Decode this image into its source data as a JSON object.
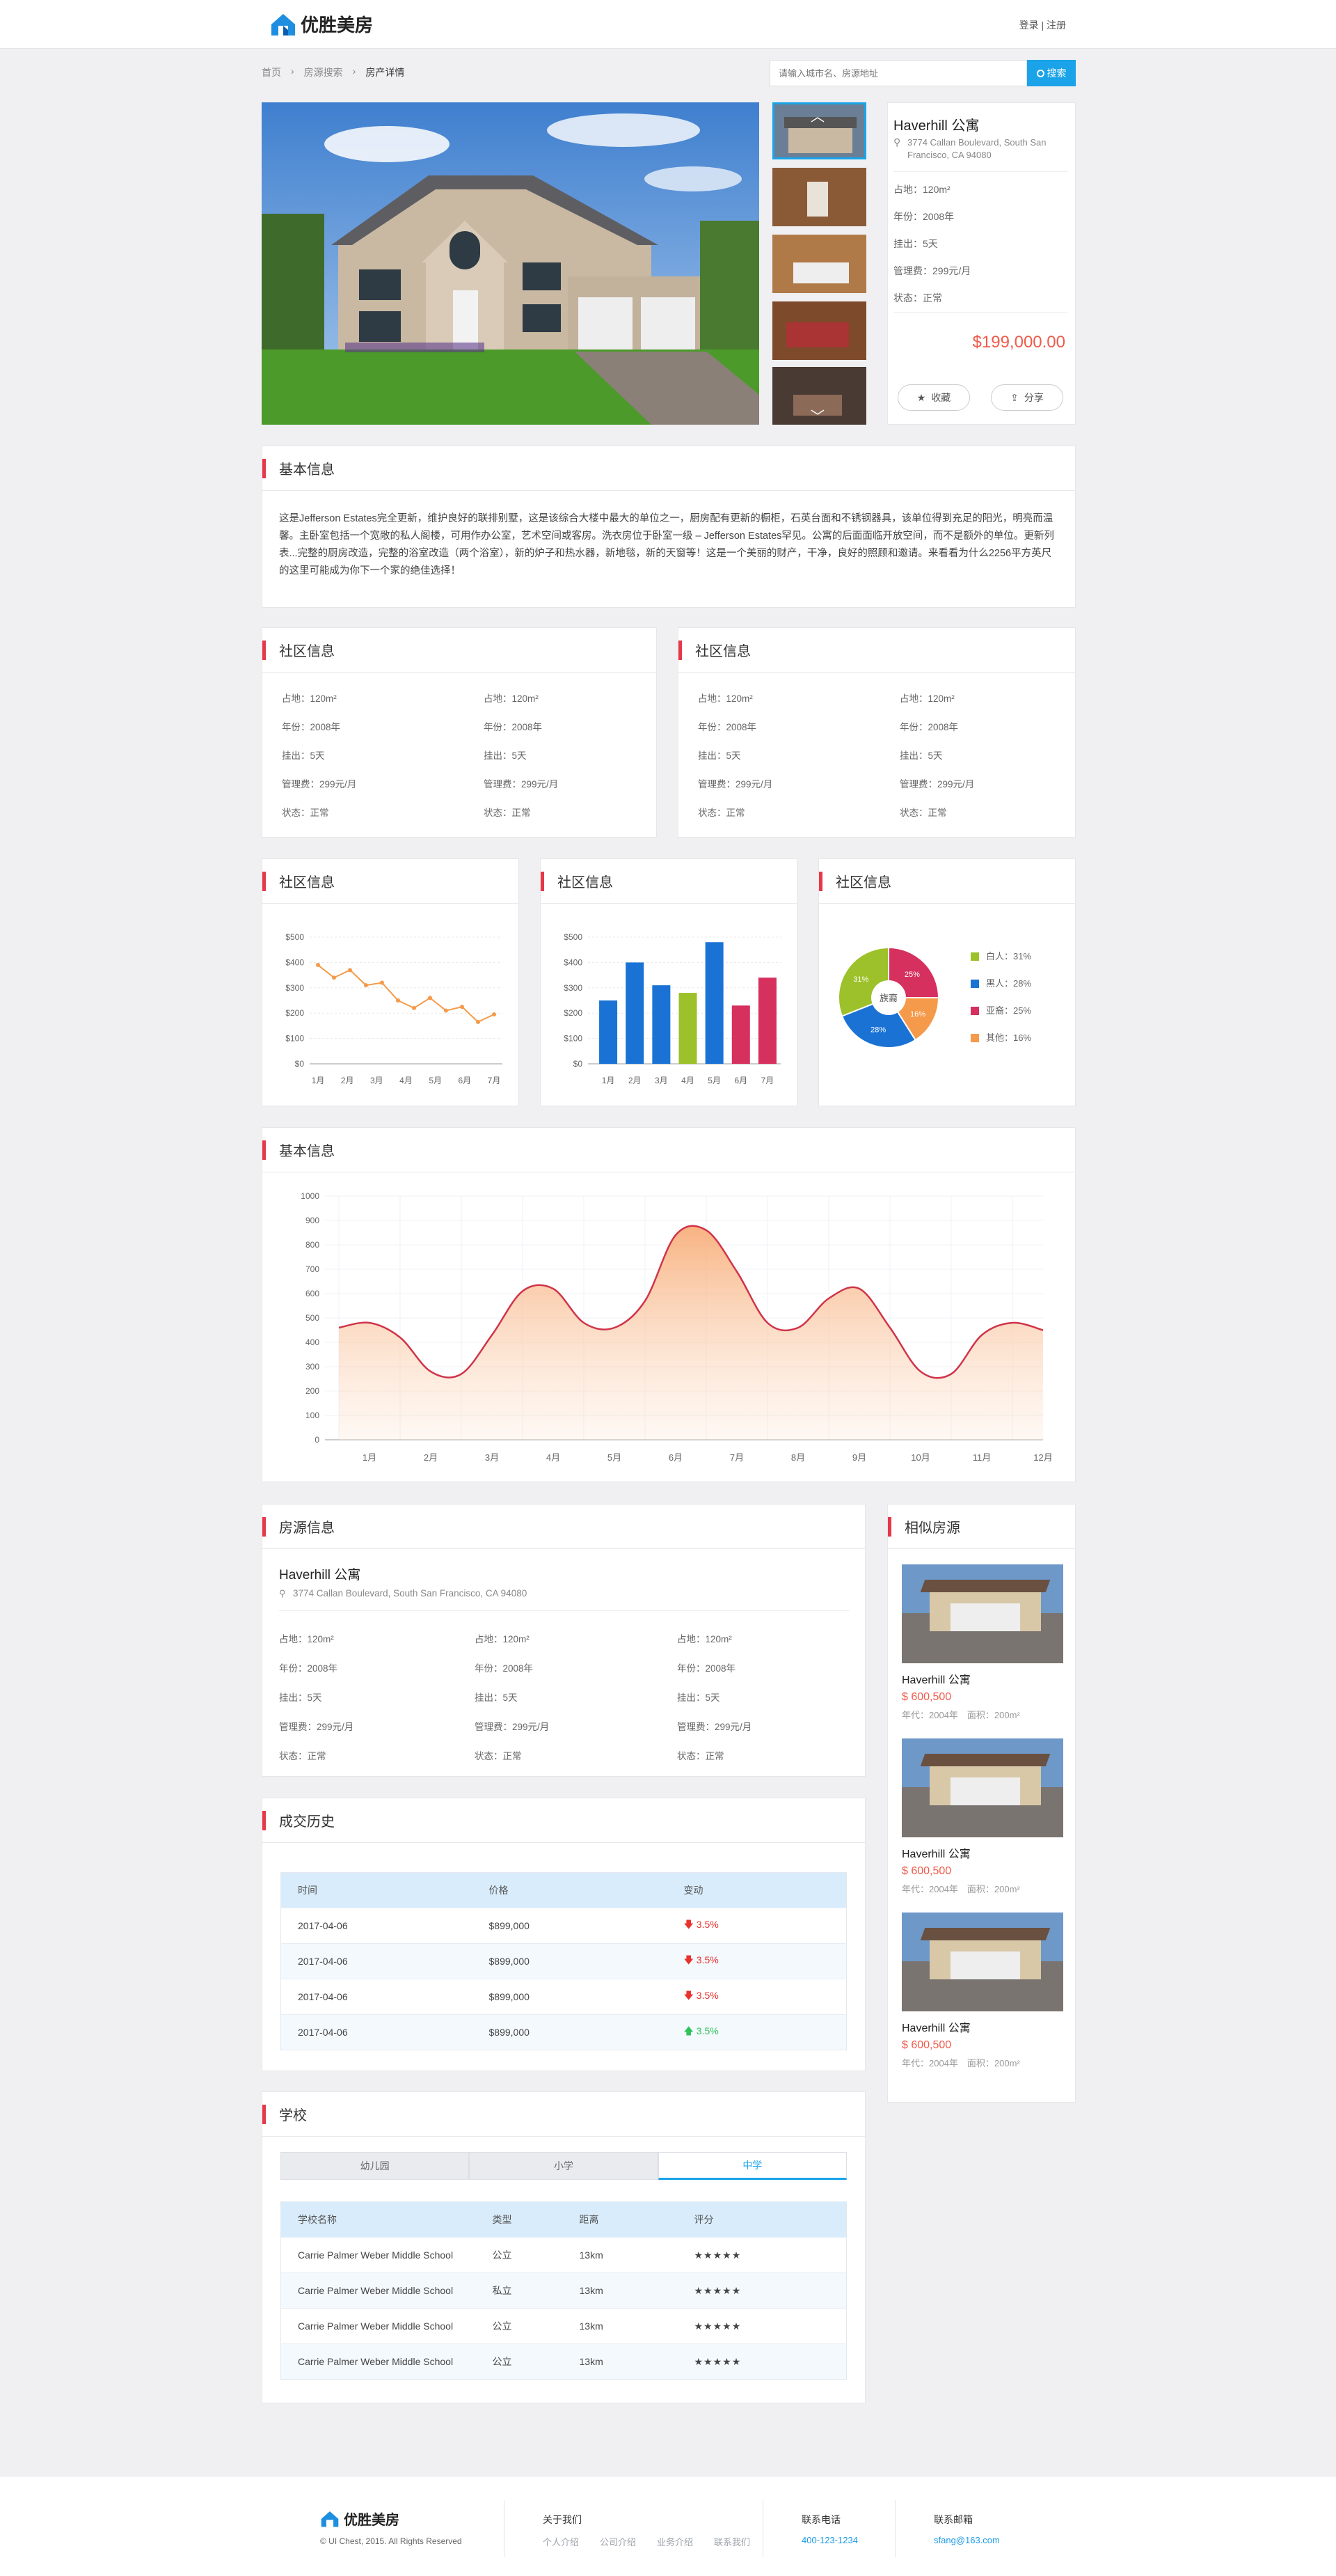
{
  "header": {
    "brand": "优胜美房",
    "auth": "登录 | 注册"
  },
  "breadcrumb": {
    "home": "首页",
    "search": "房源搜索",
    "current": "房产详情"
  },
  "search": {
    "placeholder": "请输入城市名、房源地址",
    "button": "搜索"
  },
  "property": {
    "title": "Haverhill 公寓",
    "address": "3774 Callan Boulevard, South San Francisco, CA 94080",
    "area": "占地：120m²",
    "year": "年份：2008年",
    "listed": "挂出：5天",
    "fee": "管理费：299元/月",
    "status": "状态：正常",
    "price": "$199,000.00",
    "fav": "收藏",
    "share": "分享"
  },
  "basic": {
    "title": "基本信息",
    "text": "这是Jefferson Estates完全更新，维护良好的联排别墅，这是该综合大楼中最大的单位之一，厨房配有更新的橱柜，石英台面和不锈钢器具，该单位得到充足的阳光，明亮而温馨。主卧室包括一个宽敞的私人阁楼，可用作办公室，艺术空间或客房。洗衣房位于卧室一级 – Jefferson Estates罕见。公寓的后面面临开放空间，而不是额外的单位。更新列表...完整的厨房改造，完整的浴室改造（两个浴室），新的炉子和热水器，新地毯，新的天窗等！这是一个美丽的财产，干净，良好的照顾和邀请。来看看为什么2256平方英尺的这里可能成为你下一个家的绝佳选择！"
  },
  "community": {
    "title": "社区信息",
    "rows": [
      "占地：120m²",
      "年份：2008年",
      "挂出：5天",
      "管理费：299元/月",
      "状态：正常"
    ]
  },
  "charts": {
    "title": "社区信息",
    "big_title": "基本信息"
  },
  "chart_data": [
    {
      "type": "line",
      "title": "社区信息",
      "categories": [
        "1月",
        "2月",
        "3月",
        "4月",
        "5月",
        "6月",
        "7月"
      ],
      "yticks": [
        "$500",
        "$400",
        "$300",
        "$200",
        "$100",
        "$0"
      ],
      "ylim": [
        0,
        500
      ],
      "values": [
        390,
        340,
        370,
        310,
        320,
        250,
        220,
        260,
        210,
        225,
        165,
        195
      ]
    },
    {
      "type": "bar",
      "title": "社区信息",
      "categories": [
        "1月",
        "2月",
        "3月",
        "4月",
        "5月",
        "6月",
        "7月"
      ],
      "yticks": [
        "$500",
        "$400",
        "$300",
        "$200",
        "$100",
        "$0"
      ],
      "ylim": [
        0,
        500
      ],
      "values": [
        250,
        400,
        310,
        280,
        480,
        230,
        340
      ],
      "colors": [
        "#1a73d4",
        "#1a73d4",
        "#1a73d4",
        "#9cc12a",
        "#1a73d4",
        "#d6305e",
        "#d6305e"
      ]
    },
    {
      "type": "pie",
      "title": "社区信息",
      "center": "族裔",
      "labels": [
        "白人",
        "黑人",
        "亚裔",
        "其他"
      ],
      "values": [
        31,
        28,
        25,
        16
      ],
      "colors": [
        "#9cc12a",
        "#1a73d4",
        "#d6305e",
        "#f59a4b"
      ],
      "legend": [
        "白人：31%",
        "黑人：28%",
        "亚裔：25%",
        "其他：16%"
      ]
    },
    {
      "type": "area",
      "title": "基本信息",
      "categories": [
        "1月",
        "2月",
        "3月",
        "4月",
        "5月",
        "6月",
        "7月",
        "8月",
        "9月",
        "10月",
        "11月",
        "12月"
      ],
      "yticks": [
        "1000",
        "900",
        "800",
        "700",
        "600",
        "500",
        "400",
        "300",
        "200",
        "100",
        "0"
      ],
      "ylim": [
        0,
        1000
      ],
      "x": [
        0,
        0.5,
        1,
        1.5,
        2,
        2.5,
        3,
        3.5,
        4,
        4.5,
        5,
        5.5,
        6,
        6.5,
        7,
        7.5,
        8,
        8.5,
        9,
        9.5,
        10,
        10.5,
        11,
        11.5
      ],
      "values": [
        460,
        480,
        420,
        280,
        270,
        430,
        610,
        620,
        480,
        460,
        570,
        840,
        860,
        690,
        480,
        460,
        580,
        620,
        460,
        280,
        270,
        430,
        480,
        450
      ]
    }
  ],
  "listing": {
    "title": "房源信息",
    "name": "Haverhill 公寓",
    "address": "3774 Callan Boulevard, South San Francisco, CA 94080"
  },
  "similar": {
    "title": "相似房源",
    "items": [
      {
        "name": "Haverhill 公寓",
        "price": "$ 600,500",
        "meta": "年代：2004年　面积：200m²"
      },
      {
        "name": "Haverhill 公寓",
        "price": "$ 600,500",
        "meta": "年代：2004年　面积：200m²"
      },
      {
        "name": "Haverhill 公寓",
        "price": "$ 600,500",
        "meta": "年代：2004年　面积：200m²"
      }
    ]
  },
  "history": {
    "title": "成交历史",
    "headers": [
      "时间",
      "价格",
      "变动"
    ],
    "rows": [
      {
        "date": "2017-04-06",
        "price": "$899,000",
        "change": "3.5%",
        "dir": "down"
      },
      {
        "date": "2017-04-06",
        "price": "$899,000",
        "change": "3.5%",
        "dir": "down"
      },
      {
        "date": "2017-04-06",
        "price": "$899,000",
        "change": "3.5%",
        "dir": "down"
      },
      {
        "date": "2017-04-06",
        "price": "$899,000",
        "change": "3.5%",
        "dir": "up"
      }
    ]
  },
  "schools": {
    "title": "学校",
    "tabs": [
      "幼儿园",
      "小学",
      "中学"
    ],
    "active_tab": 2,
    "headers": [
      "学校名称",
      "类型",
      "距离",
      "评分"
    ],
    "rows": [
      {
        "name": "Carrie Palmer Weber Middle School",
        "type": "公立",
        "dist": "13km",
        "stars": "★★★★★"
      },
      {
        "name": "Carrie Palmer Weber Middle School",
        "type": "私立",
        "dist": "13km",
        "stars": "★★★★★"
      },
      {
        "name": "Carrie Palmer Weber Middle School",
        "type": "公立",
        "dist": "13km",
        "stars": "★★★★★"
      },
      {
        "name": "Carrie Palmer Weber Middle School",
        "type": "公立",
        "dist": "13km",
        "stars": "★★★★★"
      }
    ]
  },
  "footer": {
    "brand": "优胜美房",
    "copyright": "© UI Chest, 2015. All Rights Reserved",
    "about": "关于我们",
    "links": [
      "个人介绍",
      "公司介绍",
      "业务介绍",
      "联系我们"
    ],
    "phone_label": "联系电话",
    "phone": "400-123-1234",
    "email_label": "联系邮箱",
    "email": "sfang@163.com"
  },
  "colors": {
    "accent": "#e6384a",
    "primary": "#1a9be6",
    "price": "#f05a4a"
  }
}
